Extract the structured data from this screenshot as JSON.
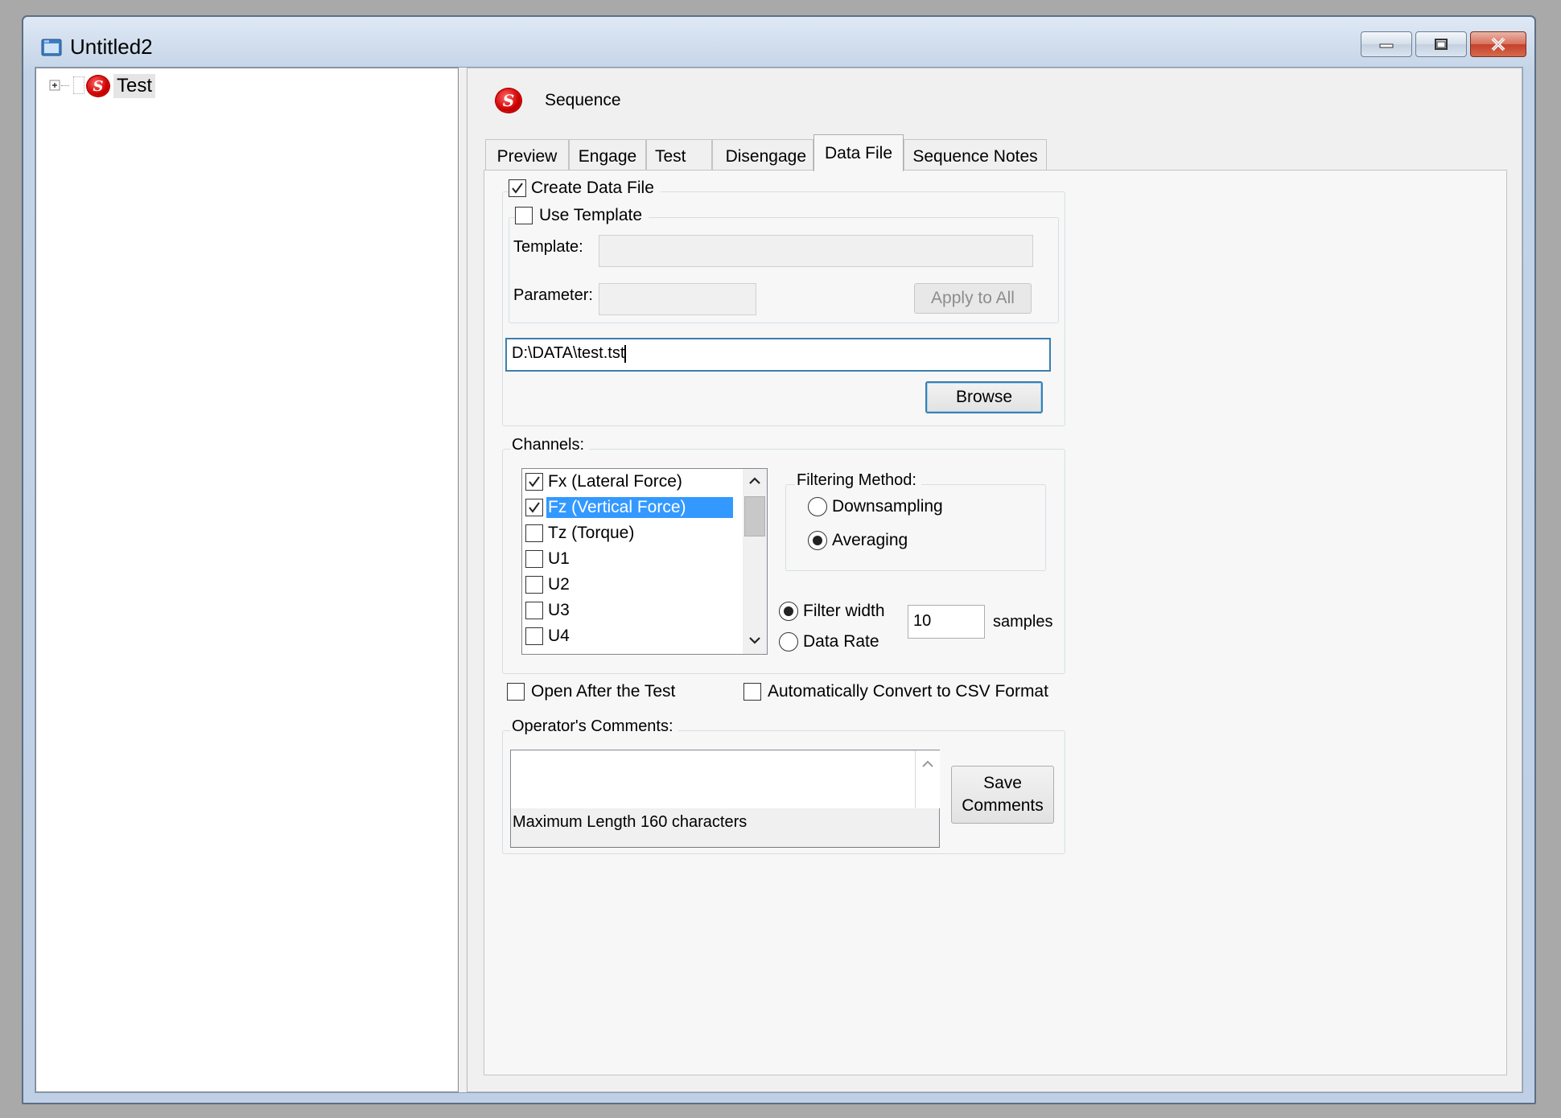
{
  "window": {
    "title": "Untitled2",
    "colors": {
      "accent": "#3399ff",
      "title_bar": "#c3d4e8",
      "close_button": "#c4402a"
    }
  },
  "tree": {
    "items": [
      {
        "label": "Test",
        "icon": "s-logo-icon",
        "expanded": false
      }
    ]
  },
  "header": {
    "title": "Sequence",
    "icon": "s-logo-icon"
  },
  "tabs": [
    {
      "label": "Preview"
    },
    {
      "label": "Engage"
    },
    {
      "label": "Test"
    },
    {
      "label": "Disengage"
    },
    {
      "label": "Data File",
      "active": true
    },
    {
      "label": "Sequence Notes"
    }
  ],
  "data_file": {
    "create_data_file": {
      "label": "Create Data File",
      "checked": true
    },
    "use_template": {
      "label": "Use Template",
      "checked": false
    },
    "template_label": "Template:",
    "template_value": "",
    "parameter_label": "Parameter:",
    "parameter_value": "",
    "apply_to_all": "Apply to All",
    "file_path": "D:\\DATA\\test.tst",
    "browse": "Browse"
  },
  "channels": {
    "label": "Channels:",
    "items": [
      {
        "label": "Fx (Lateral Force)",
        "checked": true,
        "selected": false
      },
      {
        "label": "Fz (Vertical Force)",
        "checked": true,
        "selected": true
      },
      {
        "label": "Tz (Torque)",
        "checked": false,
        "selected": false
      },
      {
        "label": "U1",
        "checked": false,
        "selected": false
      },
      {
        "label": "U2",
        "checked": false,
        "selected": false
      },
      {
        "label": "U3",
        "checked": false,
        "selected": false
      },
      {
        "label": "U4",
        "checked": false,
        "selected": false
      }
    ],
    "filtering_method": {
      "label": "Filtering Method:",
      "downsampling": "Downsampling",
      "averaging": "Averaging",
      "selected": "Averaging"
    },
    "filter_width": "Filter width",
    "data_rate": "Data Rate",
    "rate_selected": "Filter width",
    "samples_value": "10",
    "samples_unit": "samples"
  },
  "options": {
    "open_after_test": {
      "label": "Open After the Test",
      "checked": false
    },
    "convert_csv": {
      "label": "Automatically Convert to CSV Format",
      "checked": false
    }
  },
  "comments": {
    "label": "Operator's Comments:",
    "text": "Maximum Length 160 characters",
    "save_line1": "Save",
    "save_line2": "Comments"
  }
}
